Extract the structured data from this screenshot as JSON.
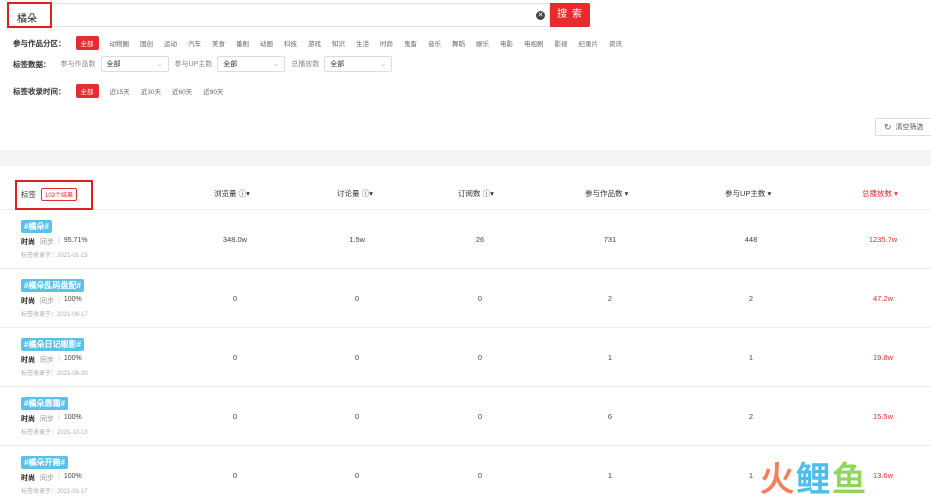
{
  "search": {
    "value": "橘朵",
    "clear_icon": "✕",
    "button": "搜 索"
  },
  "filters": {
    "category_label": "参与作品分区：",
    "categories": [
      "全部",
      "动物圈",
      "国创",
      "运动",
      "汽车",
      "美食",
      "番剧",
      "动画",
      "科技",
      "游戏",
      "知识",
      "生活",
      "时尚",
      "鬼畜",
      "音乐",
      "舞蹈",
      "娱乐",
      "电影",
      "电视剧",
      "影视",
      "纪录片",
      "资讯"
    ],
    "data_label": "标签数据：",
    "selects": [
      {
        "label": "参与作品数",
        "value": "全部"
      },
      {
        "label": "参与UP主数",
        "value": "全部"
      },
      {
        "label": "总播放数",
        "value": "全部"
      }
    ],
    "time_label": "标签收录时间：",
    "times": [
      "全部",
      "近15天",
      "近30天",
      "近60天",
      "近90天"
    ]
  },
  "reset": {
    "label": "清空筛选"
  },
  "table": {
    "tag_header": "标签",
    "count_badge": "103个结果",
    "headers": [
      {
        "label": "浏览量 ⓘ▾",
        "sorted": false
      },
      {
        "label": "讨论量 ⓘ▾",
        "sorted": false
      },
      {
        "label": "订阅数 ⓘ▾",
        "sorted": false
      },
      {
        "label": "参与作品数 ▾",
        "sorted": false
      },
      {
        "label": "参与UP主数 ▾",
        "sorted": false
      },
      {
        "label": "总播放数 ▾",
        "sorted": true
      }
    ],
    "rows": [
      {
        "tag": "#橘朵#",
        "category": "时尚",
        "related": "同步",
        "percent": "95.71%",
        "date": "标签收录于：2021-01-15",
        "views": "348.0w",
        "discussion": "1.5w",
        "subs": "26",
        "works": "731",
        "ups": "448",
        "plays": "1235.7w"
      },
      {
        "tag": "#橘朵乱码盘配#",
        "category": "时尚",
        "related": "同步",
        "percent": "100%",
        "date": "标签收录于：2021-06-17",
        "views": "0",
        "discussion": "0",
        "subs": "0",
        "works": "2",
        "ups": "2",
        "plays": "47.2w"
      },
      {
        "tag": "#橘朵日记眼影#",
        "category": "时尚",
        "related": "同步",
        "percent": "100%",
        "date": "标签收录于：2021-06-20",
        "views": "0",
        "discussion": "0",
        "subs": "0",
        "works": "1",
        "ups": "1",
        "plays": "19.8w"
      },
      {
        "tag": "#橘朵唇霜#",
        "category": "时尚",
        "related": "同步",
        "percent": "100%",
        "date": "标签收录于：2021-10-13",
        "views": "0",
        "discussion": "0",
        "subs": "0",
        "works": "6",
        "ups": "2",
        "plays": "15.5w"
      },
      {
        "tag": "#橘朵开箱#",
        "category": "时尚",
        "related": "同步",
        "percent": "100%",
        "date": "标签收录于：2021-01-17",
        "views": "0",
        "discussion": "0",
        "subs": "0",
        "works": "1",
        "ups": "1",
        "plays": "13.6w"
      }
    ]
  },
  "watermark": {
    "a": "火",
    "b": "鲤",
    "c": "鱼"
  },
  "colors": {
    "accent": "#e62c2c",
    "tag_bg": "#5cc1e8"
  }
}
